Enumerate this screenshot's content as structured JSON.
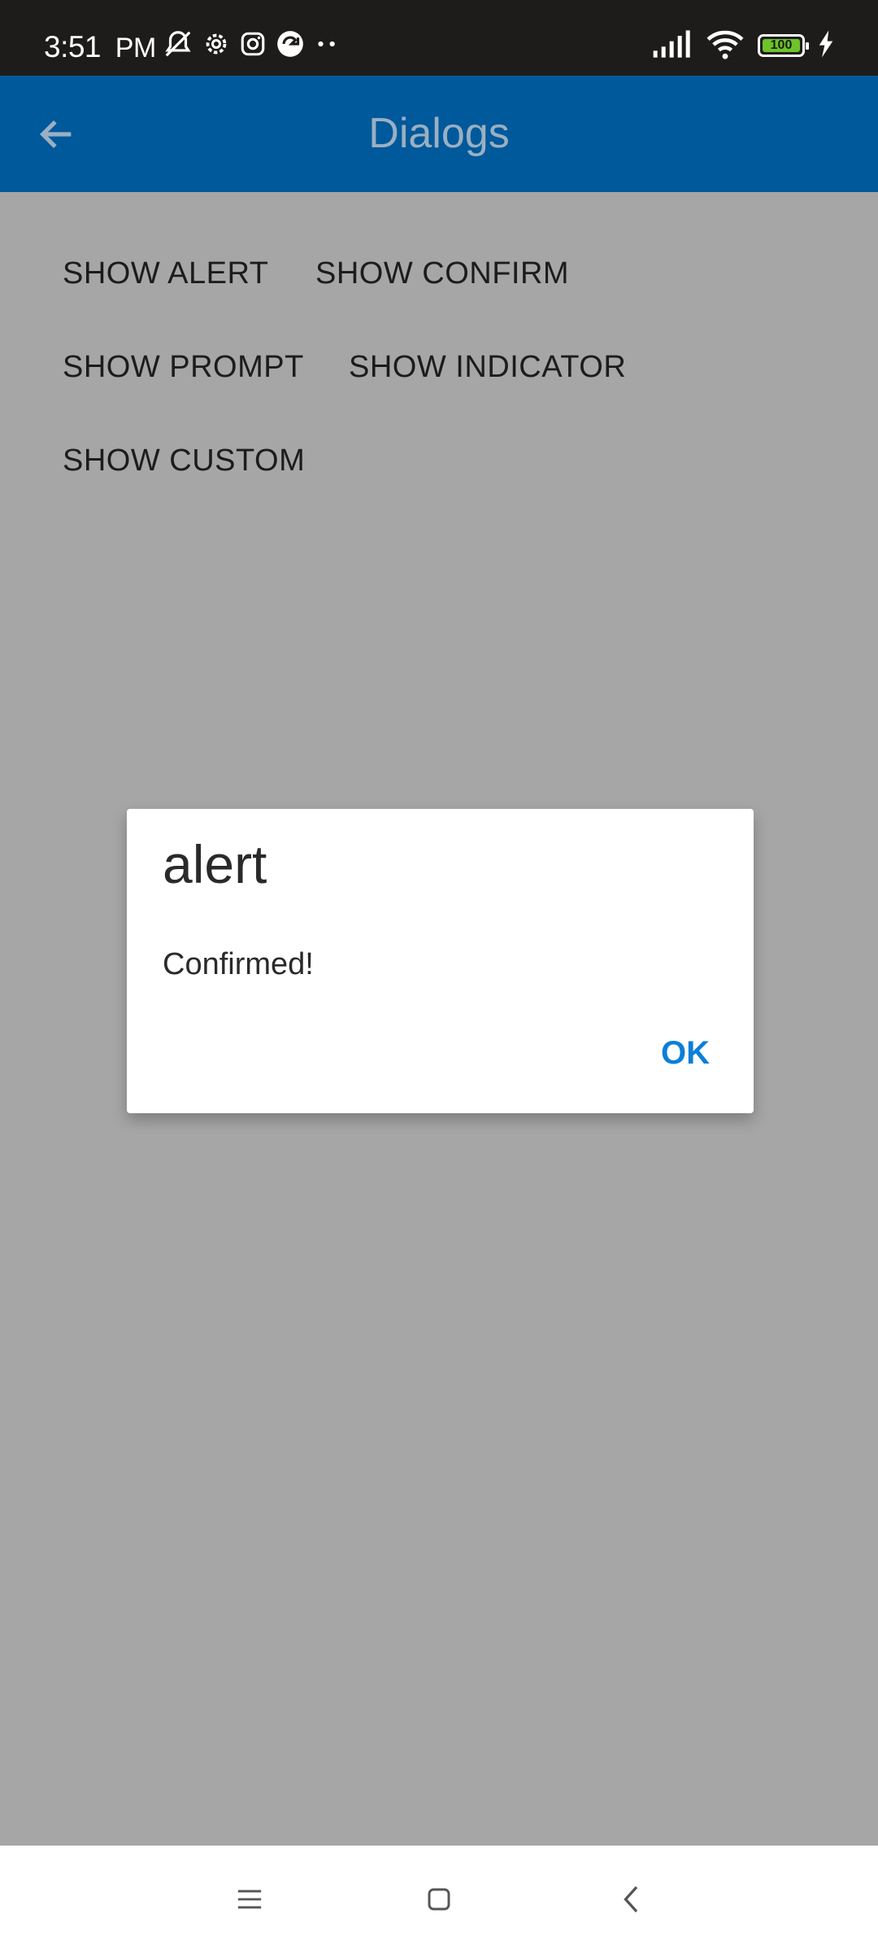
{
  "status_bar": {
    "time": "3:51",
    "am_pm": "PM",
    "battery": "100",
    "left_icons": [
      "mute-icon",
      "settings-icon",
      "instagram-icon",
      "app-icon",
      "more-dots-icon"
    ],
    "right_icons": [
      "signal-icon",
      "wifi-icon",
      "battery-icon",
      "charging-icon"
    ]
  },
  "app_bar": {
    "title": "Dialogs",
    "back_icon": "arrow-back-icon",
    "color": "#00599b"
  },
  "buttons": {
    "show_alert": "SHOW ALERT",
    "show_confirm": "SHOW CONFIRM",
    "show_prompt": "SHOW PROMPT",
    "show_indicator": "SHOW INDICATOR",
    "show_custom": "SHOW CUSTOM"
  },
  "dialog": {
    "title": "alert",
    "message": "Confirmed!",
    "ok_label": "OK",
    "accent": "#0a7fd9"
  },
  "nav_bar": {
    "icons": [
      "menu-icon",
      "home-icon",
      "back-icon"
    ]
  }
}
